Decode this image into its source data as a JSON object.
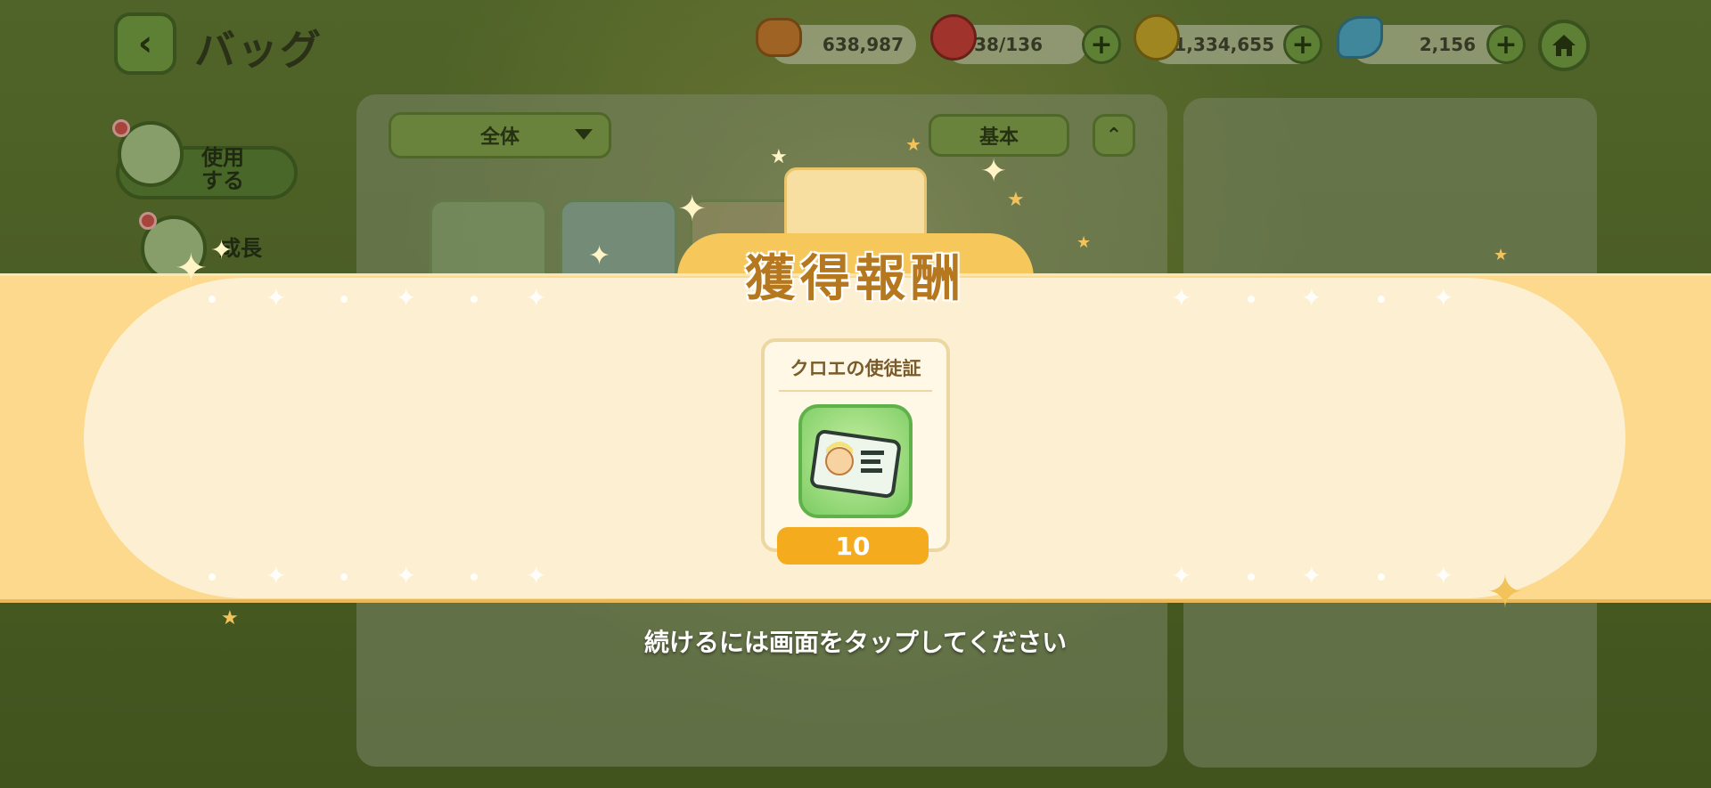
{
  "header": {
    "title": "バッグ"
  },
  "resources": [
    {
      "name": "coin",
      "value": "638,987",
      "color": "#c7742a",
      "icon": "cookie-coin-icon"
    },
    {
      "name": "stamina",
      "value": "38/136",
      "color": "#c93434",
      "icon": "red-gem-icon"
    },
    {
      "name": "gold",
      "value": "1,334,655",
      "color": "#c9a226",
      "icon": "gold-coin-icon"
    },
    {
      "name": "butterfly",
      "value": "2,156",
      "color": "#4aa3c9",
      "icon": "butterfly-icon"
    }
  ],
  "sidebar": {
    "items": [
      {
        "label": "使用\nする",
        "icon": "pouch-icon"
      },
      {
        "label": "成長",
        "icon": "potion-icon"
      }
    ]
  },
  "toolbar": {
    "filter_label": "全体",
    "sort_label": "基本"
  },
  "reward": {
    "title": "獲得報酬",
    "item_name": "クロエの使徒証",
    "quantity": "10",
    "icon": "id-card-icon"
  },
  "hint": "続けるには画面をタップしてください",
  "colors": {
    "band": "#fcd98c",
    "pill": "#fdf0d2",
    "quantity_badge": "#f4ac1e",
    "title_gold": "#b5781f"
  }
}
